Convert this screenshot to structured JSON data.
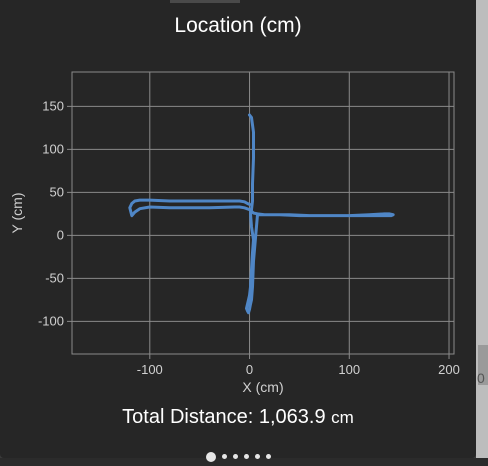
{
  "title": "Location (cm)",
  "total": {
    "label": "Total Distance: 1,063.9",
    "unit": "cm"
  },
  "pager": {
    "count": 6,
    "active_index": 0
  },
  "right_peek_text": "0",
  "colors": {
    "background": "#262626",
    "grid": "#8a8a8a",
    "axis_text": "#d0d0d0",
    "path": "#4f86c6",
    "title": "#ffffff"
  },
  "chart_data": {
    "type": "line",
    "title": "",
    "xlabel": "X (cm)",
    "ylabel": "Y (cm)",
    "xlim": [
      -178,
      205
    ],
    "ylim": [
      -138,
      190
    ],
    "x_ticks": [
      -100,
      0,
      100,
      200
    ],
    "y_ticks": [
      150,
      100,
      50,
      0,
      -50,
      -100
    ],
    "x_tick_labels": [
      "-100",
      "0",
      "100",
      "200"
    ],
    "y_tick_labels": [
      "150",
      "100",
      "50",
      "0",
      "-50",
      "-100"
    ],
    "grid": true,
    "series": [
      {
        "x": [
          0,
          2,
          4,
          4,
          3,
          3,
          2,
          1,
          2,
          4,
          3,
          2,
          1,
          0,
          -1,
          -2,
          -3,
          -2,
          -1,
          0,
          1,
          2,
          3,
          4,
          8,
          20,
          40,
          60,
          80,
          100,
          120,
          135,
          140,
          144,
          142,
          130,
          110,
          90,
          70,
          50,
          30,
          15,
          8,
          4,
          2,
          0,
          -5,
          -10,
          -15,
          -40,
          -60,
          -80,
          -100,
          -110,
          -115,
          -118,
          -120,
          -118,
          -115,
          -110,
          -100,
          -80,
          -60,
          -40,
          -20,
          -10,
          -5,
          -2,
          0
        ],
        "y": [
          140,
          137,
          120,
          90,
          60,
          40,
          30,
          25,
          10,
          -5,
          -20,
          -40,
          -60,
          -70,
          -75,
          -80,
          -85,
          -88,
          -90,
          -86,
          -80,
          -75,
          -60,
          -30,
          24,
          24,
          24,
          23,
          23,
          23,
          24,
          25,
          25,
          24,
          23,
          23,
          23,
          23,
          23,
          23,
          24,
          24,
          25,
          26,
          28,
          30,
          32,
          33,
          33,
          32,
          32,
          32,
          33,
          31,
          27,
          23,
          32,
          37,
          40,
          41,
          41,
          40,
          40,
          40,
          40,
          40,
          39,
          37,
          36
        ]
      }
    ]
  }
}
